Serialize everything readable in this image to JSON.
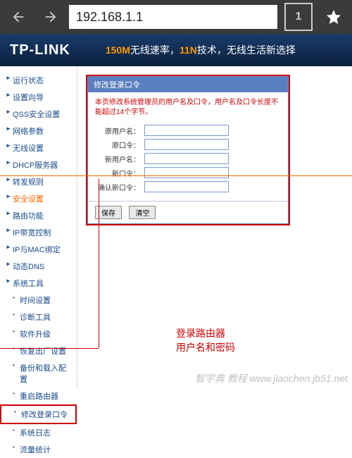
{
  "browser": {
    "url": "192.168.1.1",
    "tab_count": "1"
  },
  "banner": {
    "logo": "TP-LINK",
    "speed": "150M",
    "t1": "无线速率，",
    "tech": "11N",
    "t2": "技术，无线生活新选择"
  },
  "sidebar": {
    "items": [
      {
        "label": "运行状态"
      },
      {
        "label": "设置向导"
      },
      {
        "label": "QSS安全设置"
      },
      {
        "label": "网络参数"
      },
      {
        "label": "无线设置"
      },
      {
        "label": "DHCP服务器"
      },
      {
        "label": "转发规则"
      },
      {
        "label": "安全设置",
        "active": true
      },
      {
        "label": "路由功能"
      },
      {
        "label": "IP带宽控制"
      },
      {
        "label": "IP与MAC绑定"
      },
      {
        "label": "动态DNS"
      },
      {
        "label": "系统工具"
      }
    ],
    "subitems": [
      {
        "label": "时间设置"
      },
      {
        "label": "诊断工具"
      },
      {
        "label": "软件升级"
      },
      {
        "label": "恢复出厂设置"
      },
      {
        "label": "备份和载入配置"
      },
      {
        "label": "重启路由器"
      },
      {
        "label": "修改登录口令",
        "highlighted": true
      },
      {
        "label": "系统日志"
      },
      {
        "label": "流量统计"
      }
    ]
  },
  "panel": {
    "title": "修改登录口令",
    "hint": "本页修改系统管理员的用户名及口令，用户名及口令长度不能超过14个字节。",
    "fields": {
      "old_user": "原用户名：",
      "old_pass": "原口令：",
      "new_user": "新用户名：",
      "new_pass": "新口令：",
      "confirm": "确认新口令："
    },
    "buttons": {
      "save": "保存",
      "clear": "清空"
    }
  },
  "annotation": {
    "l1": "登录路由器",
    "l2": "用户名和密码"
  },
  "watermark": "智宇典 教程 www.jiaochen.jb51.net"
}
